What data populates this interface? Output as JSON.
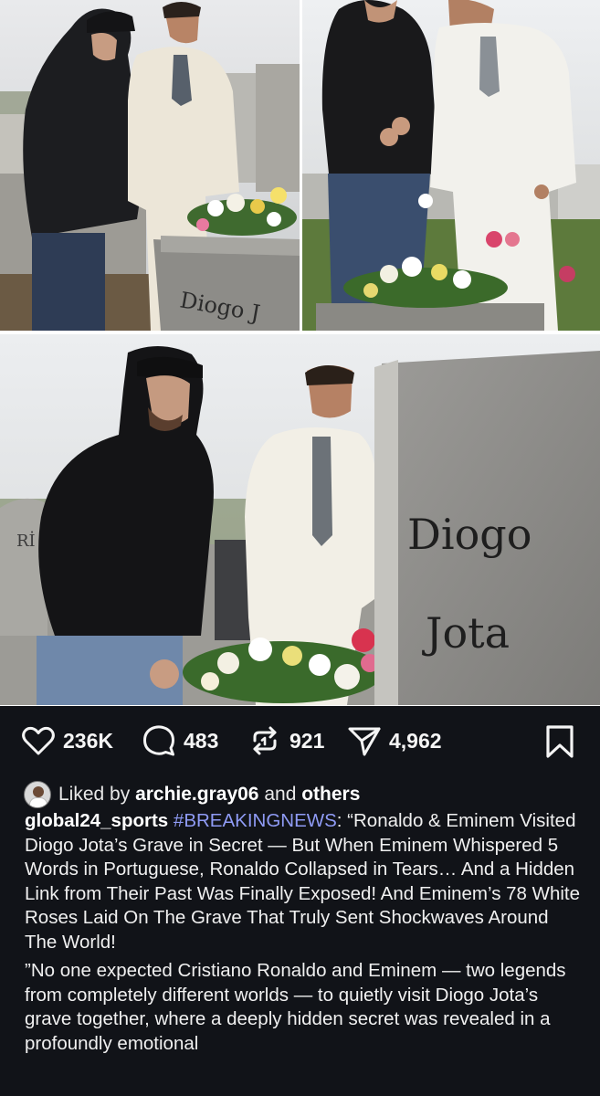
{
  "post": {
    "images": [
      {
        "description": "photo-left-top"
      },
      {
        "description": "photo-right-top"
      },
      {
        "description": "photo-bottom-wide"
      }
    ],
    "grave_text": {
      "line1": "Diogo",
      "line2": "Jota"
    },
    "actions": {
      "like_count": "236K",
      "comment_count": "483",
      "repost_count": "921",
      "share_count": "4,962"
    },
    "liked_by": {
      "prefix": "Liked by",
      "user": "archie.gray06",
      "joiner": "and",
      "others": "others"
    },
    "caption": {
      "username": "global24_sports",
      "hashtag": "#BREAKINGNEWS",
      "text": ": “Ronaldo & Eminem Visited Diogo Jota’s Grave in Secret — But When Eminem Whispered 5 Words in Portuguese, Ronaldo Collapsed in Tears… And a Hidden Link from Their Past Was Finally Exposed! And Eminem’s 78 White Roses Laid On The Grave That Truly Sent Shockwaves Around The World!",
      "paragraph2": "”No one expected Cristiano Ronaldo and Eminem — two legends from completely different worlds — to quietly visit Diogo Jota’s grave together, where a deeply hidden secret was revealed in a profoundly emotional"
    },
    "colors": {
      "panel_bg": "#111318",
      "hashtag": "#8f9bf5",
      "text": "#f0f0f0"
    }
  }
}
